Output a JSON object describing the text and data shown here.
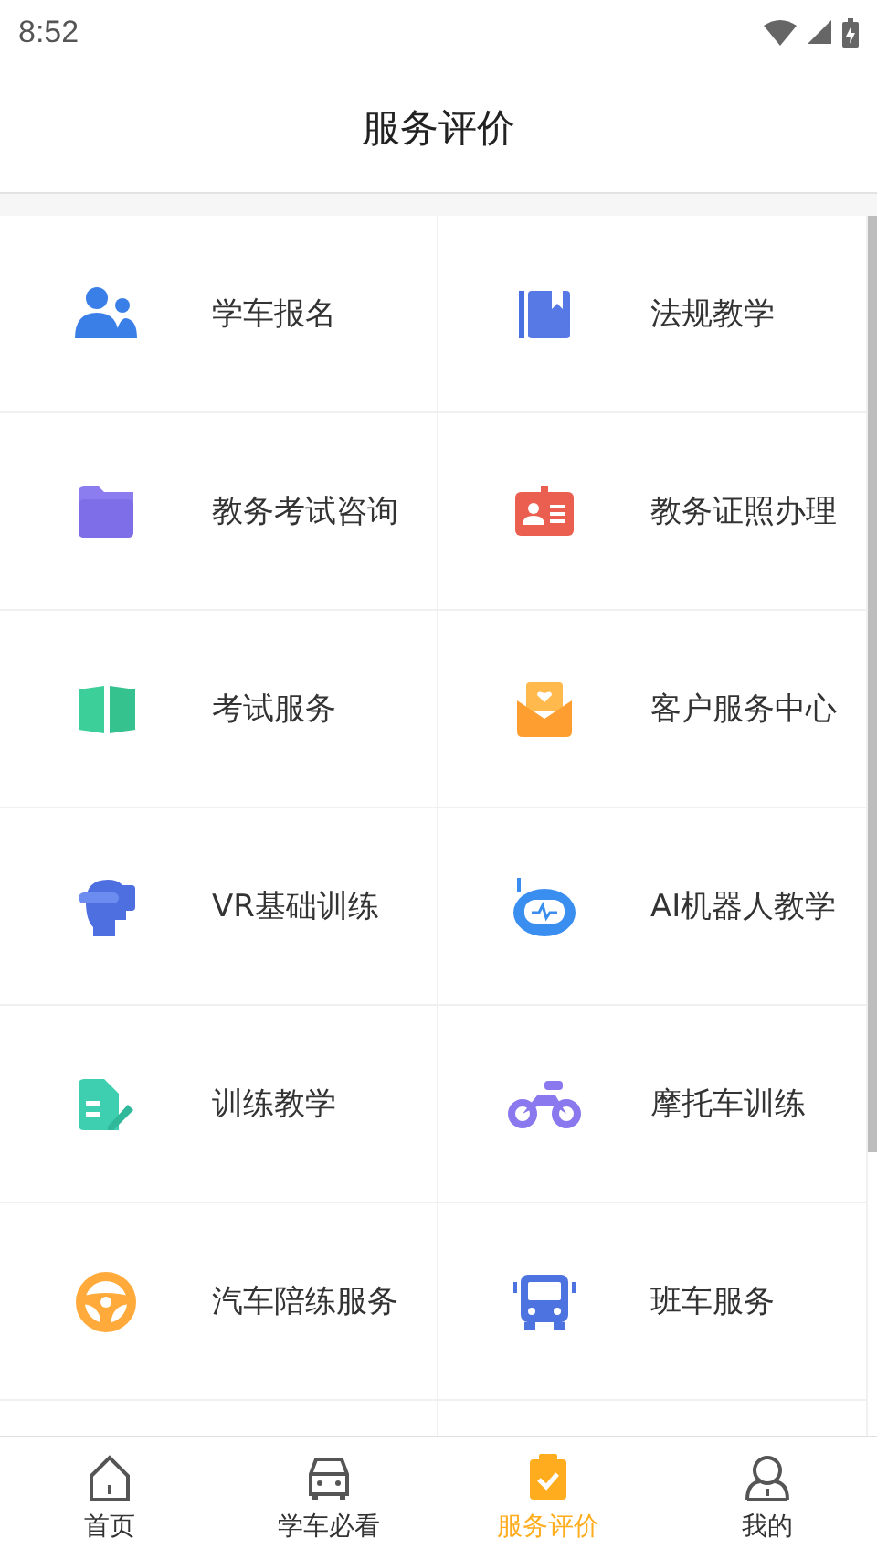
{
  "status_bar": {
    "time": "8:52"
  },
  "header": {
    "title": "服务评价"
  },
  "services": [
    {
      "label": "学车报名"
    },
    {
      "label": "法规教学"
    },
    {
      "label": "教务考试咨询"
    },
    {
      "label": "教务证照办理"
    },
    {
      "label": "考试服务"
    },
    {
      "label": "客户服务中心"
    },
    {
      "label": "VR基础训练"
    },
    {
      "label": "AI机器人教学"
    },
    {
      "label": "训练教学"
    },
    {
      "label": "摩托车训练"
    },
    {
      "label": "汽车陪练服务"
    },
    {
      "label": "班车服务"
    }
  ],
  "tab_bar": [
    {
      "label": "首页",
      "selected": false
    },
    {
      "label": "学车必看",
      "selected": false
    },
    {
      "label": "服务评价",
      "selected": true
    },
    {
      "label": "我的",
      "selected": false
    }
  ]
}
